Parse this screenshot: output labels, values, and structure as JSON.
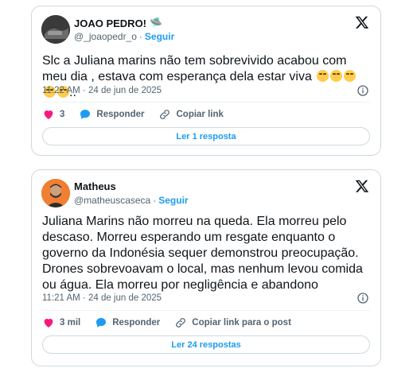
{
  "tweets": [
    {
      "author_name": "JOAO PEDRO!",
      "name_emoji": "🛸",
      "handle": "@_joaopedr_o",
      "separator": "·",
      "follow_label": "Seguir",
      "text": "Slc a Juliana marins não tem sobrevivido acabou com meu dia , estava com esperança dela estar viva ",
      "text_suffix": "..",
      "emoji_count": 5,
      "time": "11:22 AM · 24 de jun de 2025",
      "like_count": "3",
      "reply_label": "Responder",
      "copy_label": "Copiar link",
      "replies_button": "Ler 1 resposta"
    },
    {
      "author_name": "Matheus",
      "handle": "@matheuscaseca",
      "separator": "·",
      "follow_label": "Seguir",
      "text": "Juliana Marins não morreu na queda. Ela morreu pelo descaso. Morreu esperando um resgate enquanto o governo da Indonésia sequer demonstrou preocupação. Drones sobrevoavam o local, mas nenhum levou comida ou água. Ela morreu por negligência e abandono",
      "time": "11:21 AM · 24 de jun de 2025",
      "like_count": "3 mil",
      "reply_label": "Responder",
      "copy_label": "Copiar link para o post",
      "replies_button": "Ler 24 respostas"
    }
  ],
  "colors": {
    "accent": "#1d9bf0",
    "like": "#f91880",
    "muted": "#536471",
    "border": "#cfd9de"
  },
  "icons": [
    "x-logo-icon",
    "info-icon",
    "heart-icon",
    "reply-bubble-icon",
    "link-icon"
  ]
}
